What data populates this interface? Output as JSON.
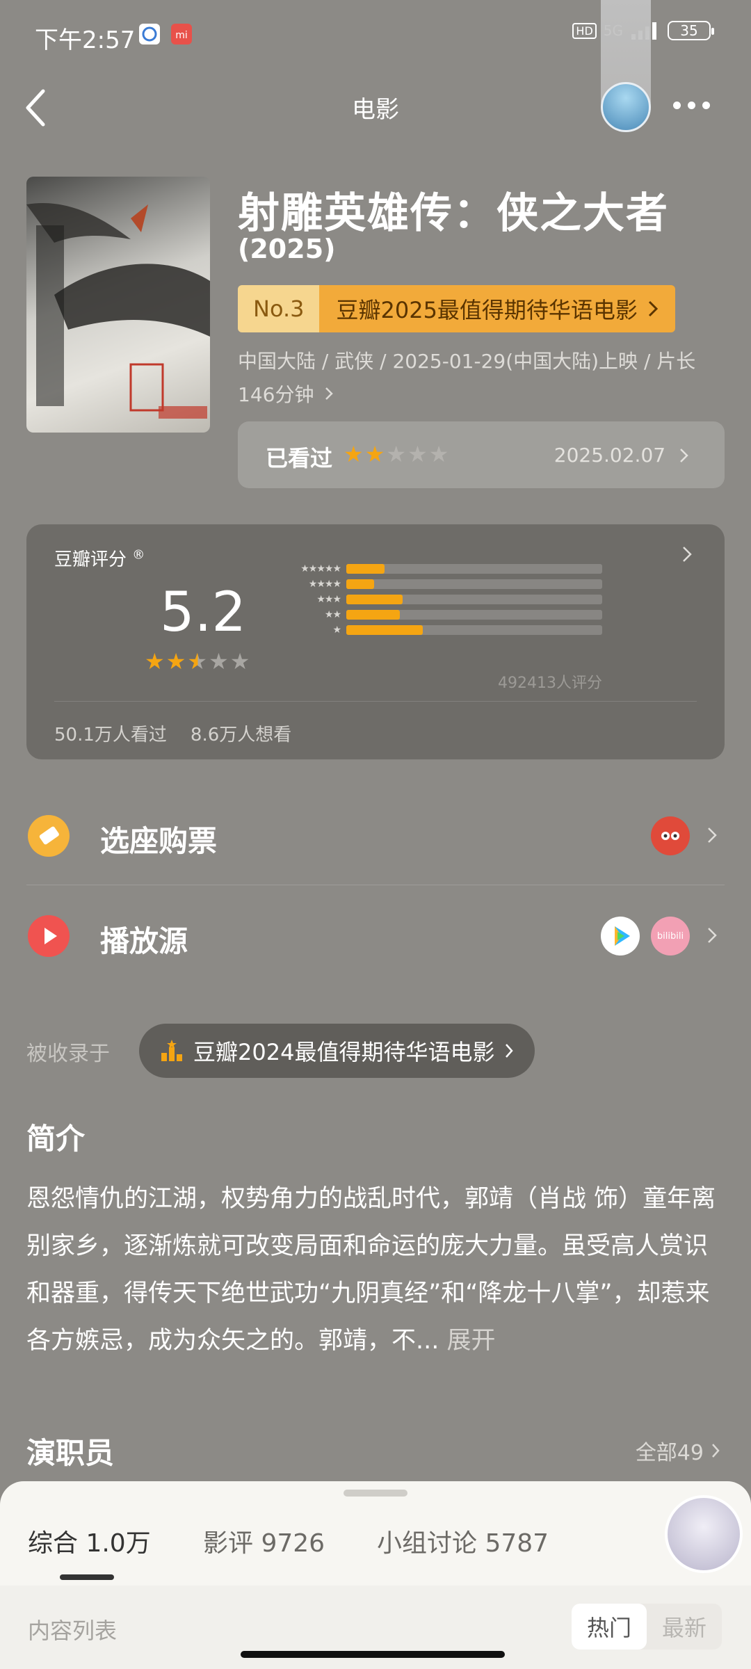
{
  "status_bar": {
    "time": "下午2:57",
    "network": "5G",
    "battery": "35",
    "hd": "HD"
  },
  "header": {
    "title": "电影"
  },
  "movie": {
    "title": "射雕英雄传：侠之大者",
    "year": "(2025)",
    "rank_no": "No.3",
    "rank_text": "豆瓣2025最值得期待华语电影",
    "meta": "中国大陆 / 武侠 / 2025-01-29(中国大陆)上映 / 片长146分钟",
    "watched_label": "已看过",
    "watched_rating": 2,
    "watched_date": "2025.02.07"
  },
  "rating": {
    "label": "豆瓣评分",
    "registered": "®",
    "score": "5.2",
    "stars": 2.5,
    "distribution": [
      {
        "stars": "★★★★★",
        "percent": 15
      },
      {
        "stars": "★★★★",
        "percent": 11
      },
      {
        "stars": "★★★",
        "percent": 22
      },
      {
        "stars": "★★",
        "percent": 21
      },
      {
        "stars": "★",
        "percent": 30
      }
    ],
    "count": "492413人评分",
    "watched": "50.1万人看过",
    "want": "8.6万人想看"
  },
  "actions": {
    "tickets": "选座购票",
    "play": "播放源",
    "bilibili": "bilibili"
  },
  "collection": {
    "label": "被收录于",
    "chip": "豆瓣2024最值得期待华语电影"
  },
  "synopsis": {
    "title": "简介",
    "text": "恩怨情仇的江湖，权势角力的战乱时代，郭靖（肖战 饰）童年离别家乡，逐渐炼就可改变局面和命运的庞大力量。虽受高人赏识和器重，得传天下绝世武功“九阴真经”和“降龙十八掌”，却惹来各方嫉忌，成为众矢之的。郭靖，不...",
    "expand": "展开"
  },
  "cast": {
    "title": "演职员",
    "more": "全部49"
  },
  "sheet": {
    "tabs": [
      "综合 1.0万",
      "影评 9726",
      "小组讨论 5787"
    ],
    "list_label": "内容列表",
    "sort_hot": "热门",
    "sort_new": "最新"
  },
  "colors": {
    "accent_orange": "#f5a512",
    "rank_badge": "#f2aa3a",
    "background": "#8c8a86"
  }
}
